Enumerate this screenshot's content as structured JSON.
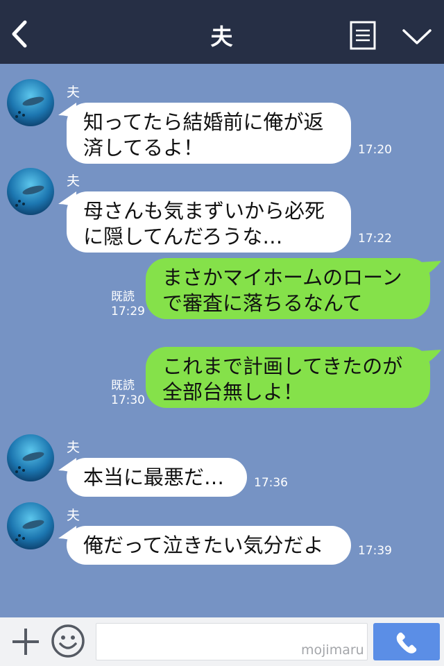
{
  "header": {
    "title": "夫"
  },
  "messages": [
    {
      "sender": "夫",
      "line1": "知ってたら結婚前に俺が返",
      "line2": "済してるよ！",
      "time": "17:20"
    },
    {
      "sender": "夫",
      "line1": "母さんも気まずいから必死",
      "line2": "に隠してんだろうな…",
      "time": "17:22"
    },
    {
      "read": "既読",
      "line1": "まさかマイホームのローン",
      "line2": "で審査に落ちるなんて",
      "time": "17:29"
    },
    {
      "read": "既読",
      "line1": "これまで計画してきたのが",
      "line2": "全部台無しよ！",
      "time": "17:30"
    },
    {
      "sender": "夫",
      "line1": "本当に最悪だ…",
      "time": "17:36"
    },
    {
      "sender": "夫",
      "line1": "俺だって泣きたい気分だよ",
      "time": "17:39"
    }
  ],
  "input": {
    "value": "",
    "watermark": "mojimaru"
  },
  "colors": {
    "header_bg": "#262f45",
    "chat_bg": "#7693c4",
    "incoming_bubble": "#ffffff",
    "outgoing_bubble": "#85e14a",
    "call_button": "#5b8ee6"
  },
  "icons": {
    "back": "chevron-left-icon",
    "menu": "list-icon",
    "collapse": "chevron-down-icon",
    "attach": "plus-icon",
    "emoji": "smiley-icon",
    "call": "phone-icon"
  }
}
